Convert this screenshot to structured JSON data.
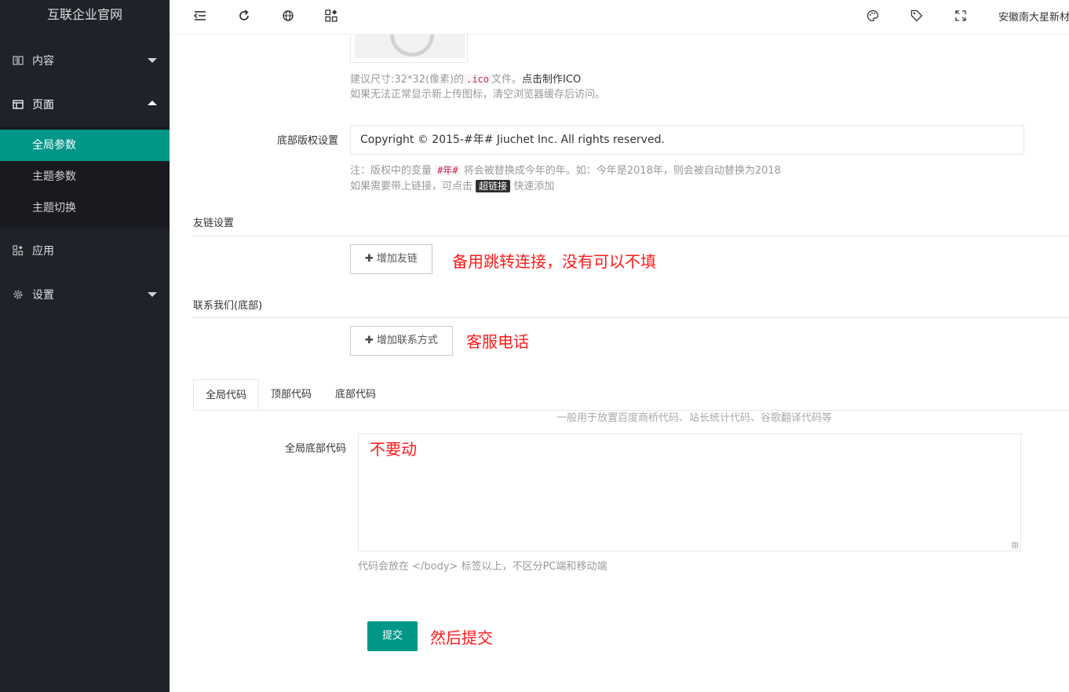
{
  "sidebar": {
    "logo": "互联企业官网",
    "items": [
      {
        "label": "内容"
      },
      {
        "label": "页面"
      },
      {
        "label": "应用"
      },
      {
        "label": "设置"
      }
    ],
    "sub_items": [
      {
        "label": "全局参数"
      },
      {
        "label": "主题参数"
      },
      {
        "label": "主题切换"
      }
    ]
  },
  "header": {
    "user": "安徽南大星新材"
  },
  "icon_section": {
    "hint_prefix": "建议尺寸:32*32(像素)的",
    "ext": ".ico",
    "hint_mid": "文件。",
    "make_link": "点击制作ICO",
    "hint_line2": "如果无法正常显示新上传图标，清空浏览器缓存后访问。"
  },
  "copyright": {
    "label": "底部版权设置",
    "value": "Copyright © 2015-#年# Jiuchet Inc. All rights reserved.",
    "note_prefix": "注：版权中的变量",
    "var": "#年#",
    "note_suffix": "将会被替换成今年的年。如：今年是2018年，则会被自动替换为2018",
    "link_prefix": "如果需要带上链接，可点击",
    "link_badge": "超链接",
    "link_suffix": "快速添加"
  },
  "friend_links": {
    "title": "友链设置",
    "button": "增加友链",
    "annotation": "备用跳转连接，没有可以不填"
  },
  "contact": {
    "title": "联系我们(底部)",
    "button": "增加联系方式",
    "annotation": "客服电话"
  },
  "tabs": [
    {
      "label": "全局代码"
    },
    {
      "label": "顶部代码"
    },
    {
      "label": "底部代码"
    }
  ],
  "code": {
    "tab_hint": "一般用于放置百度商桥代码、站长统计代码、谷歌翻译代码等",
    "label": "全局底部代码",
    "annotation": "不要动",
    "hint": "代码会放在 </body> 标签以上，不区分PC端和移动端"
  },
  "submit": {
    "label": "提交",
    "annotation": "然后提交"
  },
  "colors": {
    "sidebar_bg": "#20222a",
    "accent": "#009688",
    "annotation_red": "#ff1a1a"
  }
}
